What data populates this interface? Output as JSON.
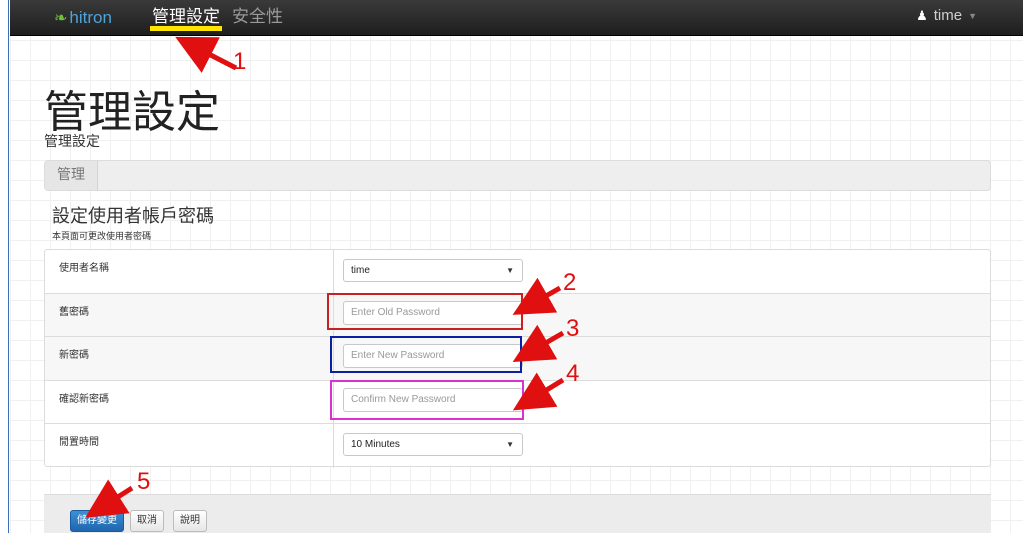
{
  "brand": {
    "logo_text": "hitron",
    "logo_mark": "❧"
  },
  "nav": {
    "active": "管理設定",
    "other": "安全性",
    "user": "time"
  },
  "header": {
    "title": "管理設定",
    "subtitle": "管理設定"
  },
  "tabs": {
    "current": "管理"
  },
  "section": {
    "title": "設定使用者帳戶密碼",
    "description": "本頁面可更改使用者密碼"
  },
  "form": {
    "username": {
      "label": "使用者名稱",
      "value": "time"
    },
    "old_password": {
      "label": "舊密碼",
      "placeholder": "Enter Old Password"
    },
    "new_password": {
      "label": "新密碼",
      "placeholder": "Enter New Password"
    },
    "confirm_password": {
      "label": "確認新密碼",
      "placeholder": "Confirm New Password"
    },
    "idle_time": {
      "label": "閒置時間",
      "value": "10 Minutes"
    }
  },
  "actions": {
    "save": "儲存變更",
    "cancel": "取消",
    "help": "說明"
  },
  "annotations": [
    "1",
    "2",
    "3",
    "4",
    "5"
  ],
  "colors": {
    "highlight_old": "#cc1f1f",
    "highlight_new": "#0b1fa6",
    "highlight_confirm": "#d633d1",
    "nav_underline": "#ffe600",
    "annotation": "#e01010"
  }
}
